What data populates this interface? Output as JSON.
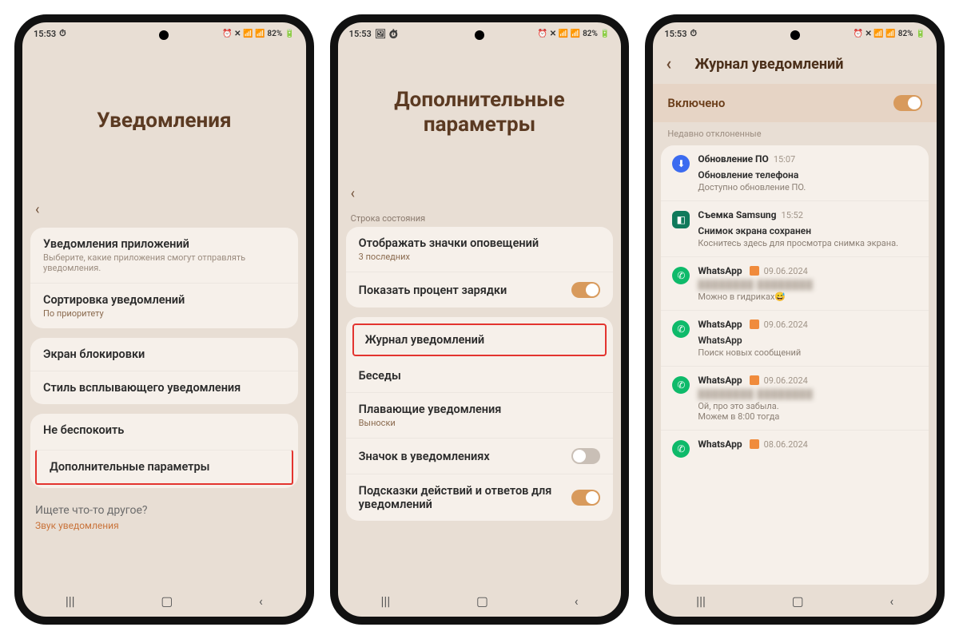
{
  "status": {
    "time": "15:53",
    "battery": "82%"
  },
  "phone1": {
    "title": "Уведомления",
    "rows": {
      "appnotif": {
        "title": "Уведомления приложений",
        "sub": "Выберите, какие приложения смогут отправлять уведомления."
      },
      "sort": {
        "title": "Сортировка уведомлений",
        "sub": "По приоритету"
      },
      "lockscreen": "Экран блокировки",
      "popupstyle": "Стиль всплывающего уведомления",
      "dnd": "Не беспокоить",
      "advanced": "Дополнительные параметры"
    },
    "footer": {
      "q": "Ищете что-то другое?",
      "hint": "Звук уведомления"
    }
  },
  "phone2": {
    "title": "Дополнительные параметры",
    "section": "Строка состояния",
    "rows": {
      "icons": {
        "title": "Отображать значки оповещений",
        "sub": "3 последних"
      },
      "battpct": "Показать процент зарядки",
      "journal": "Журнал уведомлений",
      "convos": "Беседы",
      "floating": {
        "title": "Плавающие уведомления",
        "sub": "Выноски"
      },
      "badge": "Значок в уведомлениях",
      "suggest": "Подсказки действий и ответов для уведомлений"
    }
  },
  "phone3": {
    "title": "Журнал уведомлений",
    "enabled": "Включено",
    "section": "Недавно отклоненные",
    "items": [
      {
        "icon": "blue",
        "app": "Обновление ПО",
        "time": "15:07",
        "title": "Обновление телефона",
        "body": "Доступно обновление ПО."
      },
      {
        "icon": "teal",
        "app": "Съемка Samsung",
        "time": "15:52",
        "title": "Снимок экрана сохранен",
        "body": "Коснитесь здесь для просмотра снимка экрана."
      },
      {
        "icon": "wa",
        "app": "WhatsApp",
        "orange": true,
        "time": "09.06.2024",
        "blurred": true,
        "body": "Можно в гидриках😅"
      },
      {
        "icon": "wa",
        "app": "WhatsApp",
        "orange": true,
        "time": "09.06.2024",
        "title": "WhatsApp",
        "body": "Поиск новых сообщений"
      },
      {
        "icon": "wa",
        "app": "WhatsApp",
        "orange": true,
        "time": "09.06.2024",
        "blurred": true,
        "body": "Ой, про это забыла.\nМожем в 8:00 тогда"
      },
      {
        "icon": "wa",
        "app": "WhatsApp",
        "orange": true,
        "time": "08.06.2024"
      }
    ]
  }
}
